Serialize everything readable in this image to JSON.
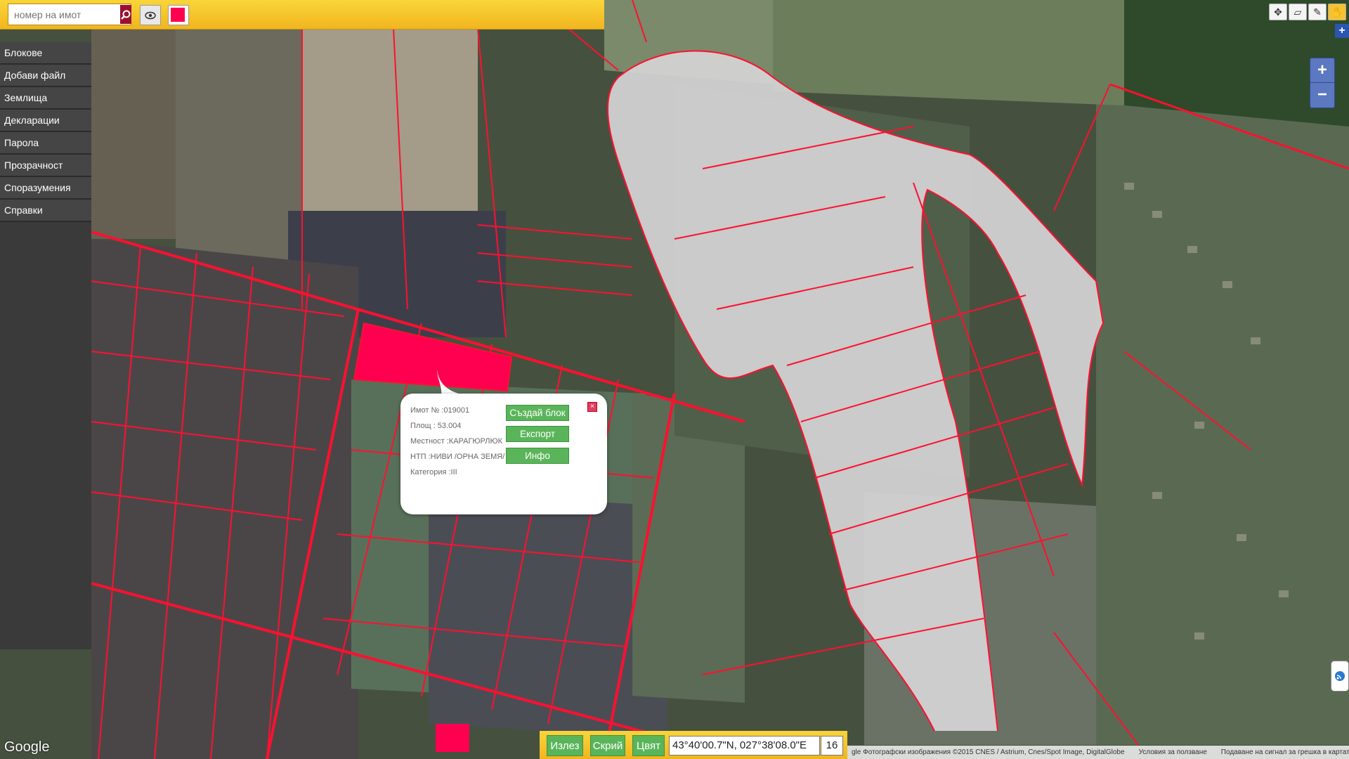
{
  "search": {
    "placeholder": "номер на имот"
  },
  "sidebar": {
    "items": [
      {
        "label": "Блокове"
      },
      {
        "label": "Добави файл"
      },
      {
        "label": "Землища"
      },
      {
        "label": "Декларации"
      },
      {
        "label": "Парола"
      },
      {
        "label": "Прозрачност"
      },
      {
        "label": "Споразумения"
      },
      {
        "label": "Справки"
      }
    ]
  },
  "popup": {
    "imot": "Имот № :019001",
    "area": "Площ : 53.004",
    "locality": "Местност :КАРАГЮРЛЮК",
    "ntp": "НТП :НИВИ /ОРНА ЗЕМЯ/",
    "category": "Категория :III",
    "btn_create": "Създай блок",
    "btn_export": "Експорт",
    "btn_info": "Инфо"
  },
  "bottom": {
    "exit": "Излез",
    "hide": "Скрий",
    "color": "Цвят",
    "coordinates": "43°40'00.7\"N, 027°38'08.0\"E",
    "zoom": "16"
  },
  "map": {
    "google_label": "Google",
    "attribution": "gle Фотографски изображения ©2015 CNES / Astrium, Cnes/Spot Image, DigitalGlobe",
    "terms": "Условия за ползване",
    "report": "Подаване на сигнал за грешка в картата"
  },
  "colors": {
    "parcel_line": "#ff1030",
    "selected_fill": "#ff0050",
    "toolbar": "#f5c330",
    "button_green": "#5ab55a"
  }
}
